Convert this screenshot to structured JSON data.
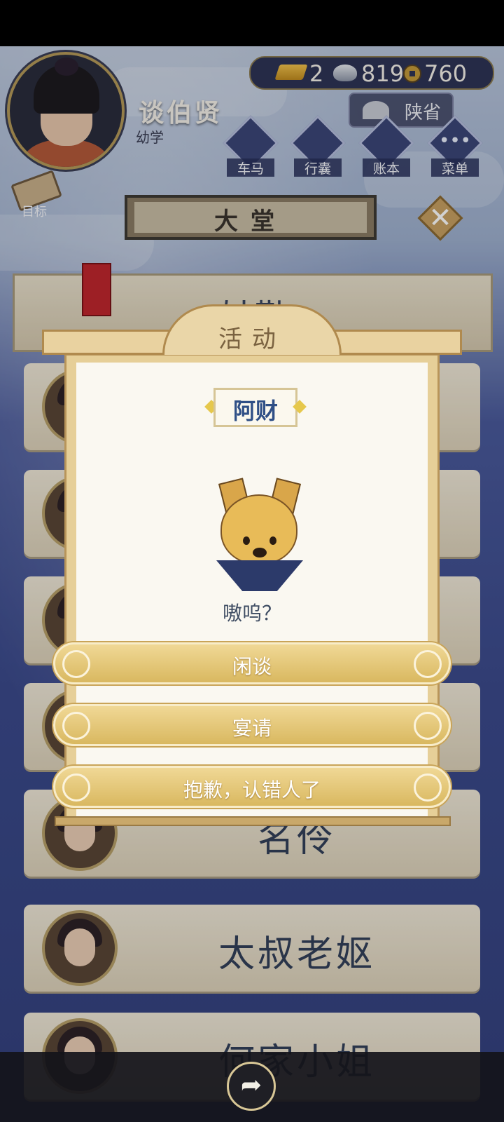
{
  "player": {
    "name": "谈伯贤",
    "rank": "幼学"
  },
  "currency": {
    "gold": "2",
    "silver": "819",
    "copper": "760"
  },
  "region": "陕省",
  "menu": [
    {
      "label": "车马",
      "icon": "carriage-icon"
    },
    {
      "label": "行囊",
      "icon": "bag-icon"
    },
    {
      "label": "账本",
      "icon": "ledger-icon"
    },
    {
      "label": "菜单",
      "icon": "more-icon"
    }
  ],
  "goal_label": "目标",
  "hall_title": "大堂",
  "close_glyph": "✕",
  "background_list": [
    {
      "name": "姑勤"
    },
    {
      "name": "名伶"
    },
    {
      "name": "太叔老妪"
    },
    {
      "name": "何家小姐"
    }
  ],
  "modal": {
    "title": "活动",
    "npc_name": "阿财",
    "dialog": "嗷呜？",
    "choices": [
      "闲谈",
      "宴请",
      "抱歉，认错人了"
    ]
  },
  "share_glyph": "➦",
  "colors": {
    "accent_gold": "#d9b860",
    "navy": "#34427f",
    "npc_name": "#2f4f86"
  }
}
